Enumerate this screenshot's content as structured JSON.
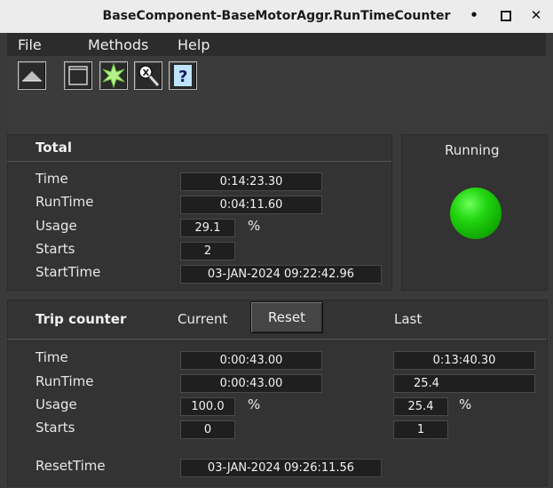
{
  "window": {
    "title": "BaseComponent-BaseMotorAggr.RunTimeCounter"
  },
  "menu": {
    "file": "File",
    "methods": "Methods",
    "help": "Help"
  },
  "toolbar": {
    "icons": [
      "up-arrow-icon",
      "window-icon",
      "star-burst-icon",
      "zoom-search-icon",
      "help-icon"
    ],
    "help_glyph": "?"
  },
  "total": {
    "header": "Total",
    "labels": {
      "time": "Time",
      "runtime": "RunTime",
      "usage": "Usage",
      "starts": "Starts",
      "starttime": "StartTime"
    },
    "values": {
      "time": "0:14:23.30",
      "runtime": "0:04:11.60",
      "usage": "29.1",
      "starts": "2",
      "starttime": "03-JAN-2024 09:22:42.96"
    },
    "usage_unit": "%"
  },
  "status": {
    "label": "Running",
    "color": "#22d611"
  },
  "trip": {
    "header": "Trip counter",
    "current_label": "Current",
    "reset_label": "Reset",
    "last_label": "Last",
    "labels": {
      "time": "Time",
      "runtime": "RunTime",
      "usage": "Usage",
      "starts": "Starts",
      "resettime": "ResetTime"
    },
    "current": {
      "time": "0:00:43.00",
      "runtime": "0:00:43.00",
      "usage": "100.0",
      "starts": "0"
    },
    "last": {
      "time": "0:13:40.30",
      "runtime": "25.4",
      "usage": "25.4",
      "starts": "1"
    },
    "usage_unit": "%",
    "resettime": "03-JAN-2024 09:26:11.56"
  }
}
